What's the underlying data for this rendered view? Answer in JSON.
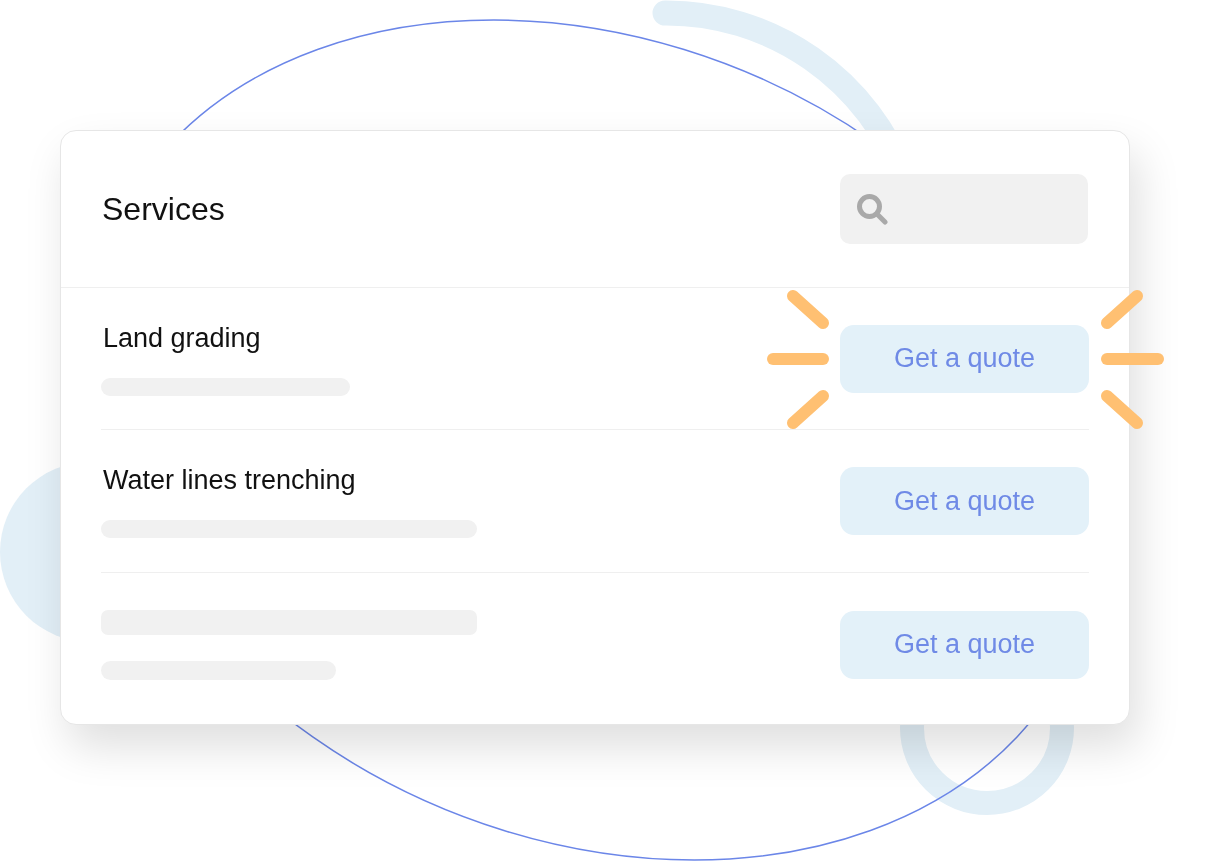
{
  "card": {
    "title": "Services",
    "services": [
      {
        "kind": "titled",
        "title": "Land grading",
        "highlighted": true,
        "button": "Get a quote"
      },
      {
        "kind": "titled",
        "title": "Water lines trenching",
        "highlighted": false,
        "button": "Get a quote"
      },
      {
        "kind": "placeholder",
        "highlighted": false,
        "button": "Get a quote"
      }
    ]
  }
}
